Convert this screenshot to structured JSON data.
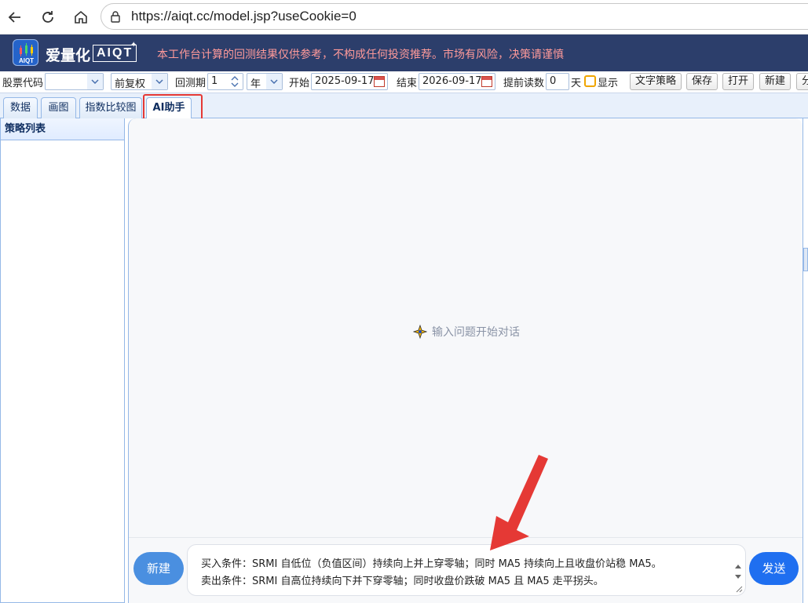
{
  "browser": {
    "url": "https://aiqt.cc/model.jsp?useCookie=0"
  },
  "header": {
    "logo_small": "AIQT",
    "brand_cn": "爱量化",
    "brand_en": "AIQT",
    "disclaimer": "本工作台计算的回测结果仅供参考，不构成任何投资推荐。市场有风险，决策请谨慎",
    "colors": {
      "bar": "#2c3e6b",
      "disclaimer": "#ff9a9a"
    }
  },
  "toolbar": {
    "stock_code_label": "股票代码",
    "stock_code_value": "",
    "adjust_value": "前复权",
    "period_label": "回测期",
    "period_value": "1",
    "period_unit": "年",
    "start_label": "开始",
    "start_value": "2025-09-17",
    "end_label": "结束",
    "end_value": "2026-09-17",
    "preread_label": "提前读数",
    "preread_value": "0",
    "preread_unit": "天",
    "show_label": "显示",
    "buttons": {
      "text_strategy": "文字策略",
      "save": "保存",
      "open": "打开",
      "new": "新建",
      "more": "分"
    }
  },
  "tabs": [
    {
      "label": "数据"
    },
    {
      "label": "画图"
    },
    {
      "label": "指数比较图"
    },
    {
      "label": "AI助手"
    }
  ],
  "left_panel": {
    "title": "策略列表"
  },
  "chat": {
    "empty_hint": "输入问题开始对话",
    "input_line1": "买入条件：SRMI 自低位（负值区间）持续向上并上穿零轴；同时 MA5 持续向上且收盘价站稳 MA5。",
    "input_line2": "卖出条件：SRMI 自高位持续向下并下穿零轴；同时收盘价跌破 MA5 且 MA5 走平拐头。",
    "new_button": "新建",
    "send_button": "发送",
    "colors": {
      "send": "#1f6ff0",
      "new": "#4a8fe0"
    }
  },
  "annotations": {
    "highlight_color": "#e53935"
  }
}
